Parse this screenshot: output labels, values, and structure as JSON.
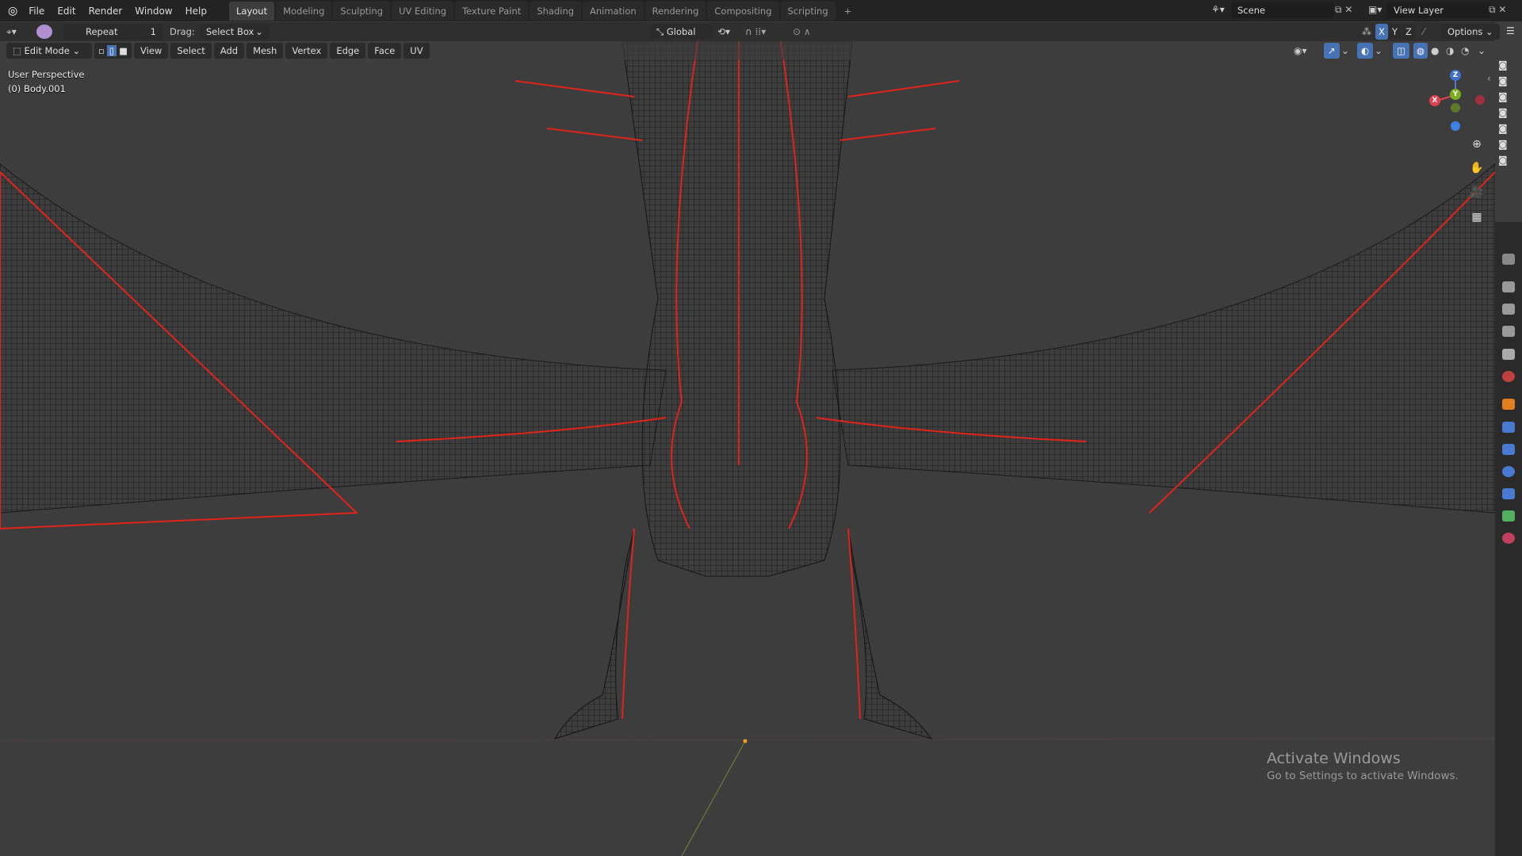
{
  "topbar": {
    "menus": [
      "File",
      "Edit",
      "Render",
      "Window",
      "Help"
    ],
    "workspaces": [
      "Layout",
      "Modeling",
      "Sculpting",
      "UV Editing",
      "Texture Paint",
      "Shading",
      "Animation",
      "Rendering",
      "Compositing",
      "Scripting"
    ],
    "active_workspace": "Layout",
    "add_tab": "+",
    "scene": "Scene",
    "view_layer": "View Layer"
  },
  "tool_header": {
    "repeat_label": "Repeat",
    "repeat_value": "1",
    "drag_label": "Drag:",
    "drag_value": "Select Box",
    "orientation": "Global",
    "axes": [
      "X",
      "Y",
      "Z"
    ],
    "options": "Options"
  },
  "view_header": {
    "mode": "Edit Mode",
    "menus": [
      "View",
      "Select",
      "Add",
      "Mesh",
      "Vertex",
      "Edge",
      "Face",
      "UV"
    ]
  },
  "overlay": {
    "view_name": "User Perspective",
    "object": "(0) Body.001"
  },
  "gizmo": {
    "x": "X",
    "y": "Y",
    "z": "Z"
  },
  "watermark": {
    "title": "Activate Windows",
    "subtitle": "Go to Settings to activate Windows."
  },
  "colors": {
    "edge": "#000000",
    "seam": "#e0231b",
    "bg": "#3d3d3d",
    "accent": "#4772b3"
  }
}
